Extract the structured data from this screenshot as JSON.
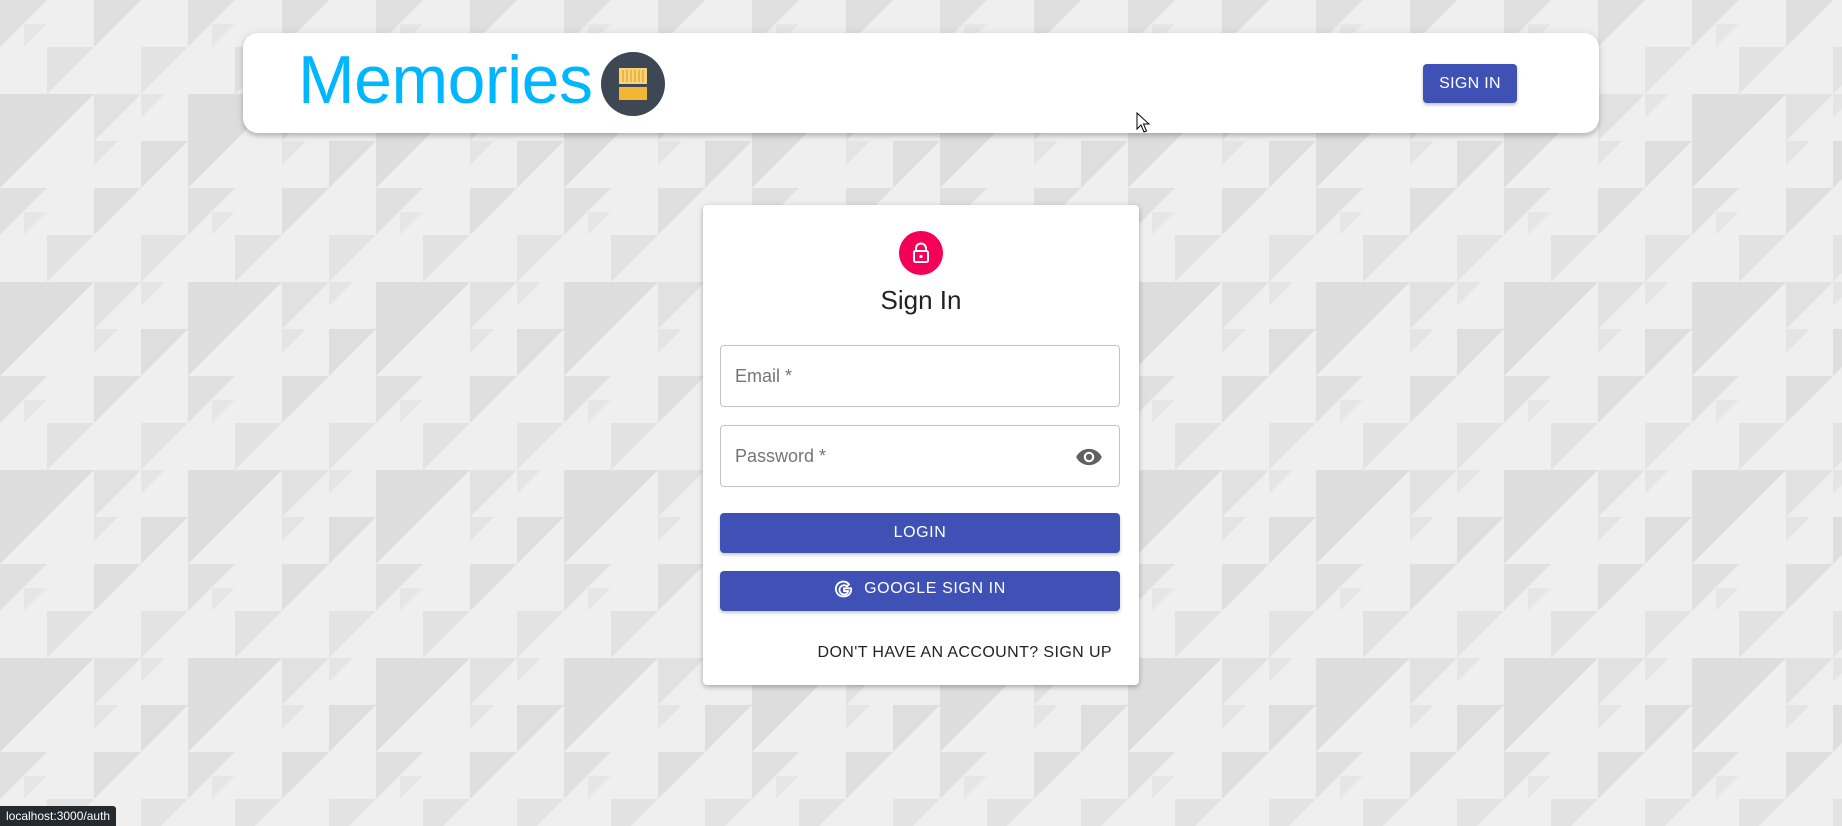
{
  "app": {
    "title": "Memories",
    "logo_icon": "memory-card-icon",
    "brand_color": "#00b7ff",
    "logo_bg_color": "#3e4754"
  },
  "header": {
    "signin_label": "SIGN IN",
    "button_color": "#3f51b5"
  },
  "auth": {
    "lock_icon": "lock-icon",
    "lock_color": "#f50057",
    "title": "Sign In",
    "email_placeholder": "Email *",
    "password_placeholder": "Password *",
    "password_toggle_icon": "eye-icon",
    "login_label": "LOGIN",
    "google_label": "GOOGLE SIGN IN",
    "google_icon": "google-g-icon",
    "switch_label": "DON'T HAVE AN ACCOUNT? SIGN UP"
  },
  "status": {
    "url": "localhost:3000/auth"
  }
}
